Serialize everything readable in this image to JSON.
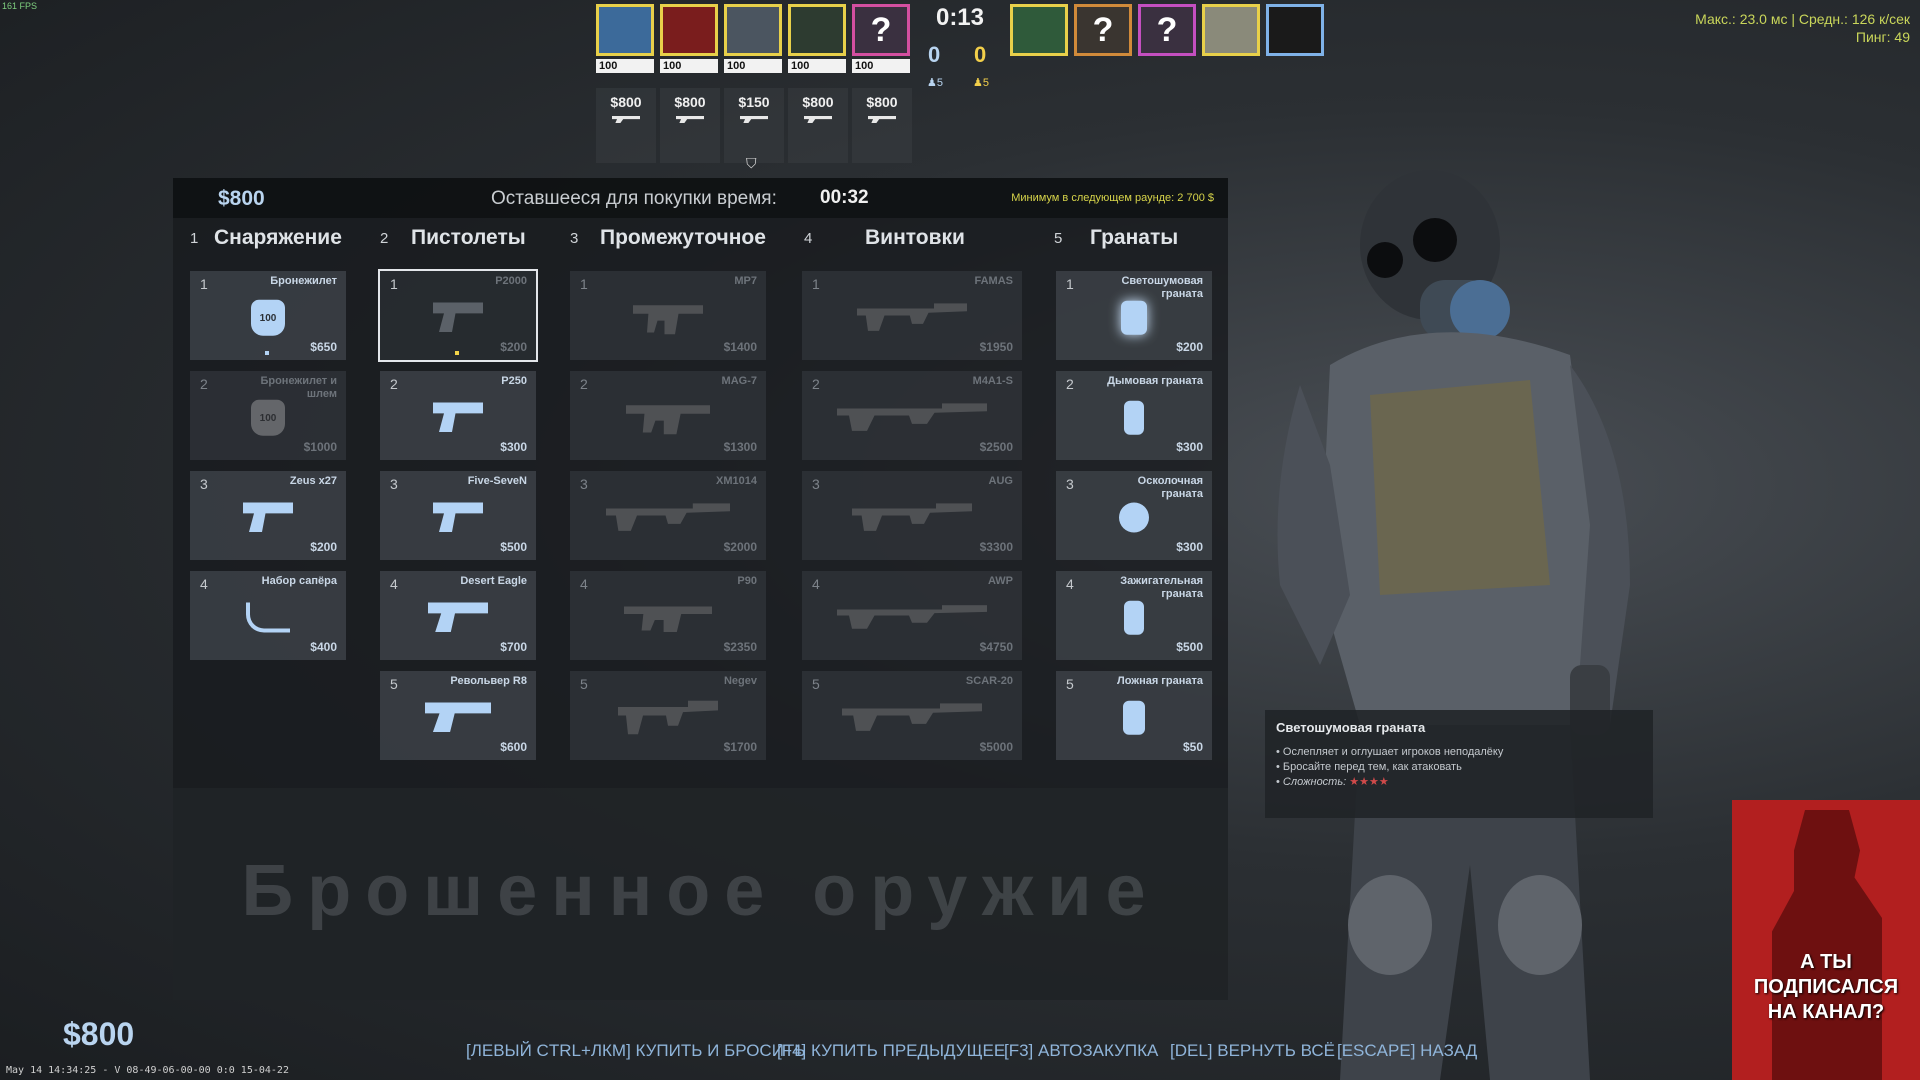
{
  "fps": "161 FPS",
  "net": {
    "line1": "Макс.: 23.0 мс | Средн.: 126 к/сек",
    "line2": "Пинг: 49"
  },
  "hud": {
    "clock": "0:13",
    "score_ct": "0",
    "score_t": "0",
    "alive_ct": "♟5",
    "alive_t": "♟5",
    "left_players": [
      {
        "hp": "100",
        "money": "$800"
      },
      {
        "hp": "100",
        "money": "$800"
      },
      {
        "hp": "100",
        "money": "$150"
      },
      {
        "hp": "100",
        "money": "$800"
      },
      {
        "hp": "100",
        "money": "$800"
      }
    ],
    "unknown_mark": "?",
    "shield_glyph": "⛉"
  },
  "buy": {
    "cash": "$800",
    "timer_label": "Оставшееся для покупки время:",
    "timer_value": "00:32",
    "minimum": "Минимум в следующем раунде: 2 700 $",
    "categories": [
      {
        "num": "1",
        "title": "Снаряжение"
      },
      {
        "num": "2",
        "title": "Пистолеты"
      },
      {
        "num": "3",
        "title": "Промежуточное"
      },
      {
        "num": "4",
        "title": "Винтовки"
      },
      {
        "num": "5",
        "title": "Гранаты"
      }
    ],
    "equipment": [
      {
        "num": "1",
        "name": "Бронежилет",
        "price": "$650",
        "icon_text": "100"
      },
      {
        "num": "2",
        "name": "Бронежилет и шлем",
        "price": "$1000",
        "icon_text": "100"
      },
      {
        "num": "3",
        "name": "Zeus x27",
        "price": "$200"
      },
      {
        "num": "4",
        "name": "Набор сапёра",
        "price": "$400"
      }
    ],
    "pistols": [
      {
        "num": "1",
        "name": "P2000",
        "price": "$200"
      },
      {
        "num": "2",
        "name": "P250",
        "price": "$300"
      },
      {
        "num": "3",
        "name": "Five-SeveN",
        "price": "$500"
      },
      {
        "num": "4",
        "name": "Desert Eagle",
        "price": "$700"
      },
      {
        "num": "5",
        "name": "Револьвер R8",
        "price": "$600"
      }
    ],
    "mid": [
      {
        "num": "1",
        "name": "MP7",
        "price": "$1400"
      },
      {
        "num": "2",
        "name": "MAG-7",
        "price": "$1300"
      },
      {
        "num": "3",
        "name": "XM1014",
        "price": "$2000"
      },
      {
        "num": "4",
        "name": "P90",
        "price": "$2350"
      },
      {
        "num": "5",
        "name": "Negev",
        "price": "$1700"
      }
    ],
    "rifles": [
      {
        "num": "1",
        "name": "FAMAS",
        "price": "$1950"
      },
      {
        "num": "2",
        "name": "M4A1-S",
        "price": "$2500"
      },
      {
        "num": "3",
        "name": "AUG",
        "price": "$3300"
      },
      {
        "num": "4",
        "name": "AWP",
        "price": "$4750"
      },
      {
        "num": "5",
        "name": "SCAR-20",
        "price": "$5000"
      }
    ],
    "grenades": [
      {
        "num": "1",
        "name": "Светошумовая граната",
        "price": "$200"
      },
      {
        "num": "2",
        "name": "Дымовая граната",
        "price": "$300"
      },
      {
        "num": "3",
        "name": "Осколочная граната",
        "price": "$300"
      },
      {
        "num": "4",
        "name": "Зажигательная граната",
        "price": "$500"
      },
      {
        "num": "5",
        "name": "Ложная граната",
        "price": "$50"
      }
    ],
    "dropped_title": "Брошенное оружие"
  },
  "tooltip": {
    "title": "Светошумовая граната",
    "line1": "• Ослепляет и оглушает игроков неподалёку",
    "line2": "• Бросайте перед тем, как атаковать",
    "difficulty_label": "Сложность:",
    "stars": "★★★★"
  },
  "footer": {
    "cash": "$800",
    "hints": [
      "[ЛЕВЫЙ CTRL+ЛКМ] КУПИТЬ И БРОСИТЬ",
      "[F4] КУПИТЬ ПРЕДЫДУЩЕЕ",
      "[F3] АВТОЗАКУПКА",
      "[DEL] ВЕРНУТЬ ВСЁ",
      "[ESCAPE] НАЗАД"
    ],
    "datestamp": "May 14 14:34:25 - V 08-49-06-00-00 0:0 15-04-22"
  },
  "poster": {
    "line1": "А ТЫ ПОДПИСАЛСЯ",
    "line2": "НА КАНАЛ?"
  },
  "colors": {
    "accent": "#b9d4ef",
    "gold": "#f2cf4a",
    "selected_outline": "#e3e6ea",
    "poster_red": "#b21f1f"
  }
}
